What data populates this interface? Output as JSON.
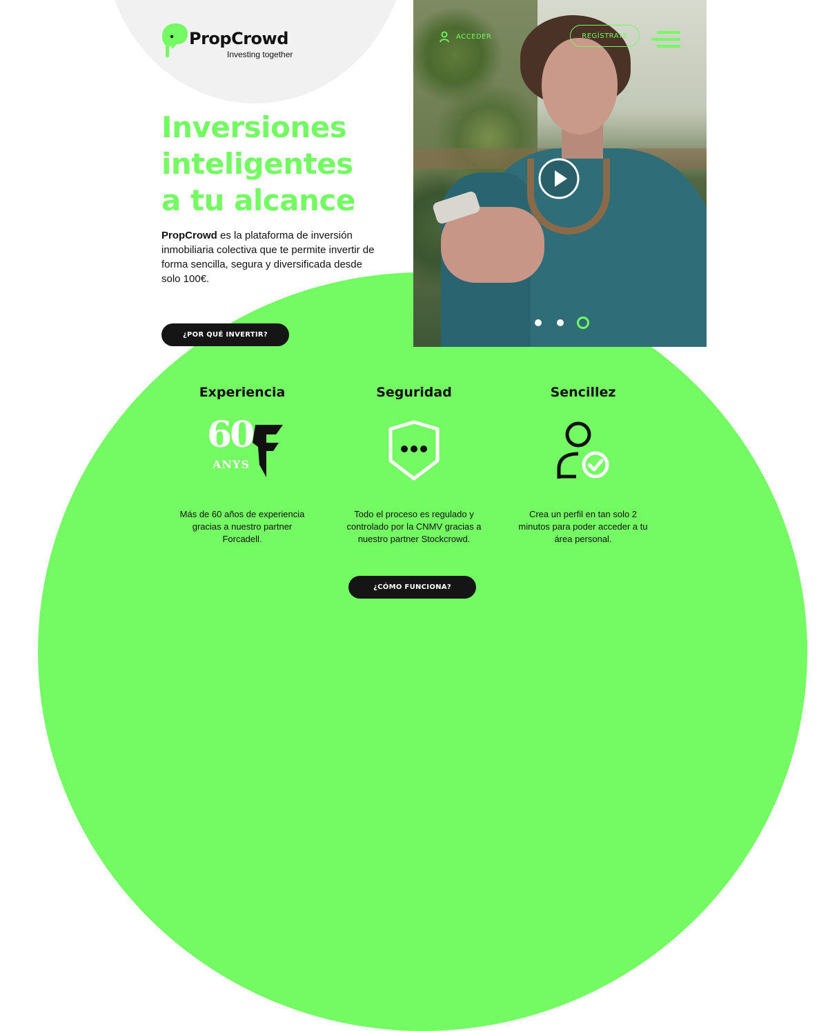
{
  "brand": {
    "name": "PropCrowd",
    "tagline": "Investing together",
    "accent_color": "#74fb63",
    "dark_color": "#151515"
  },
  "nav": {
    "login_label": "ACCEDER",
    "login_icon": "user-icon",
    "register_label": "REGÍSTRATE",
    "menu_icon": "hamburger-menu-icon"
  },
  "hero": {
    "title_lines": [
      "Inversiones",
      "inteligentes",
      "a tu alcance"
    ],
    "desc_brand": "PropCrowd",
    "desc_rest": " es la plataforma de inversión inmobiliaria colectiva que te permite invertir de forma sencilla, segura y diversificada desde solo 100€.",
    "cta_label": "¿POR QUÉ INVERTIR?",
    "play_icon": "play-icon",
    "carousel": {
      "total": 3,
      "active": 3
    }
  },
  "features": [
    {
      "title": "Experiencia",
      "icon": "forcadell-60-anys-logo",
      "logo_number": "60",
      "logo_text": "ANYS",
      "description": "Más de 60 años de experiencia gracias a nuestro partner Forcadell."
    },
    {
      "title": "Seguridad",
      "icon": "shield-password-icon",
      "description": "Todo el proceso es regulado y controlado por la CNMV gracias a nuestro partner Stockcrowd."
    },
    {
      "title": "Sencillez",
      "icon": "user-check-icon",
      "description": "Crea un perfil en tan solo 2 minutos para poder acceder a tu área personal."
    }
  ],
  "bottom_cta": {
    "label": "¿CÓMO FUNCIONA?"
  }
}
